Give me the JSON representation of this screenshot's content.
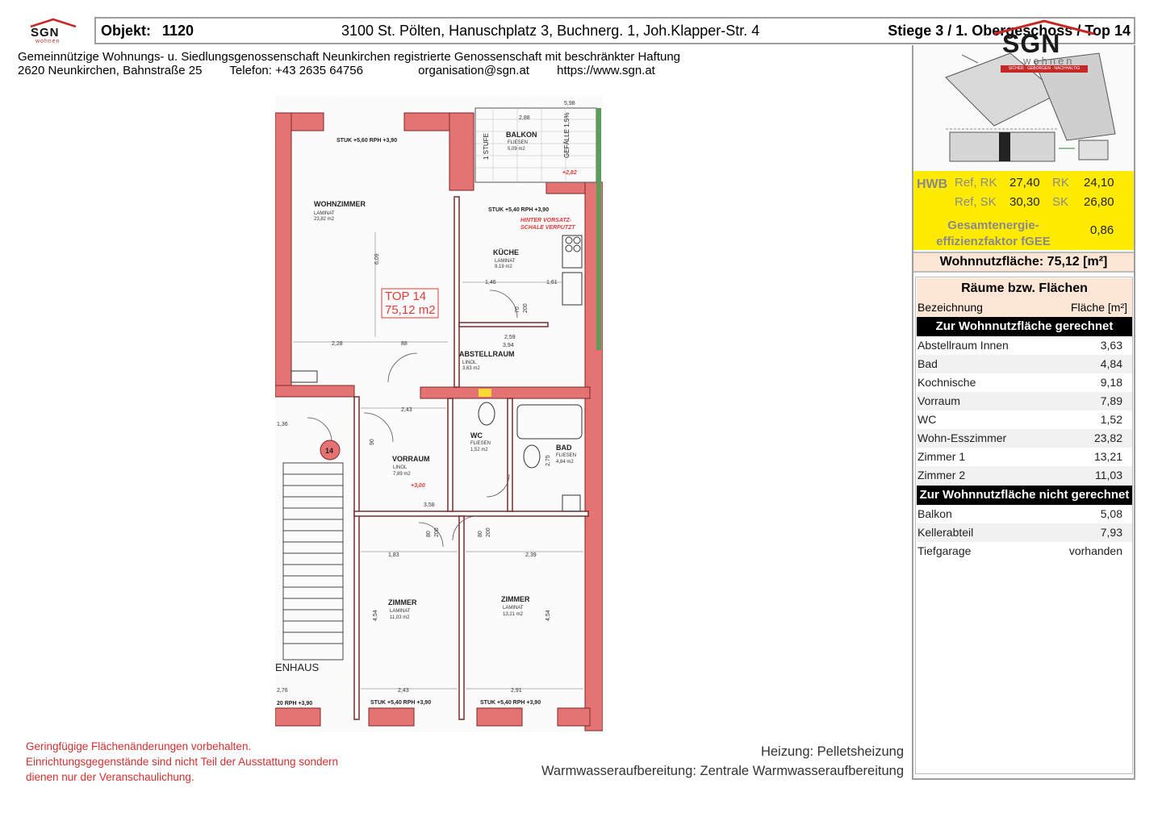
{
  "header": {
    "logo_small": "SGN",
    "logo_small_sub": "wohnen",
    "objekt_label": "Objekt:",
    "objekt_number": "1120",
    "address": "3100 St. Pölten, Hanuschplatz 3, Buchnerg. 1, Joh.Klapper-Str. 4",
    "stiege": "Stiege 3 / 1. Obergeschoss / Top 14"
  },
  "company": {
    "name": "Gemeinnützige Wohnungs- u. Siedlungsgenossenschaft Neunkirchen registrierte Genossenschaft mit beschränkter Haftung",
    "address": "2620 Neunkirchen, Bahnstraße 25",
    "phone": "Telefon: +43 2635 64756",
    "email": "organisation@sgn.at",
    "web": "https://www.sgn.at"
  },
  "brand": {
    "logo": "SGN",
    "logo_sub": "wohnen",
    "tagline": "SICHER · GEBORGEN · NACHHALTIG",
    "red": "#c62828",
    "yellow": "#ffeb00",
    "peach": "#fde6d6"
  },
  "energy": {
    "label": "HWB",
    "ref_rk_label": "Ref, RK",
    "ref_rk_value": "27,40",
    "rk_label": "RK",
    "rk_value": "24,10",
    "ref_sk_label": "Ref, SK",
    "ref_sk_value": "30,30",
    "sk_label": "SK",
    "sk_value": "26,80",
    "fgee_label_1": "Gesamtenergie-",
    "fgee_label_2": "effizienzfaktor fGEE",
    "fgee_value": "0,86"
  },
  "wohnnutzflaeche": "Wohnnutzfläche: 75,12 [m²]",
  "rooms": {
    "title": "Räume bzw. Flächen",
    "col_name": "Bezeichnung",
    "col_area": "Fläche [m²]",
    "section_included": "Zur Wohnnutzfläche gerechnet",
    "section_excluded": "Zur Wohnnutzfläche nicht gerechnet",
    "included": [
      {
        "name": "Abstellraum Innen",
        "area": "3,63"
      },
      {
        "name": "Bad",
        "area": "4,84"
      },
      {
        "name": "Kochnische",
        "area": "9,18"
      },
      {
        "name": "Vorraum",
        "area": "7,89"
      },
      {
        "name": "WC",
        "area": "1,52"
      },
      {
        "name": "Wohn-Esszimmer",
        "area": "23,82"
      },
      {
        "name": "Zimmer 1",
        "area": "13,21"
      },
      {
        "name": "Zimmer 2",
        "area": "11,03"
      }
    ],
    "excluded": [
      {
        "name": "Balkon",
        "area": "5,08"
      },
      {
        "name": "Kellerabteil",
        "area": "7,93"
      },
      {
        "name": "Tiefgarage",
        "area": "vorhanden"
      }
    ]
  },
  "plan": {
    "top_label": "TOP 14",
    "top_area": "75,12 m2",
    "wohnzimmer": "WOHNZIMMER",
    "wohnzimmer_floor": "LAMINAT",
    "wohnzimmer_area": "23,82 m2",
    "balkon": "BALKON",
    "balkon_floor": "FLIESEN",
    "balkon_area": "5,09 m2",
    "kueche": "KÜCHE",
    "kueche_floor": "LAMINAT",
    "kueche_area": "9,19 m2",
    "abstellraum": "ABSTELLRAUM",
    "abstellraum_floor": "LINOL",
    "abstellraum_area": "3,63 m2",
    "vorraum": "VORRAUM",
    "vorraum_floor": "LINOL",
    "vorraum_area": "7,89 m2",
    "wc": "WC",
    "wc_floor": "FLIESEN",
    "wc_area": "1,52 m2",
    "bad": "BAD",
    "bad_floor": "FLIESEN",
    "bad_area": "4,84 m2",
    "zimmer": "ZIMMER",
    "zimmer_floor": "LAMINAT",
    "zimmer_a_area": "11,03 m2",
    "zimmer_b_area": "13,21 m2",
    "stiegenhaus": "ENHAUS",
    "stuk_1": "STUK +5,60 RPH +3,90",
    "stuk_2": "STUK +5,40 RPH +3,90",
    "stuk_3": "STUK +5,40 RPH +3,90",
    "stuk_4": "STUK +5,40 RPH +3,90",
    "stuk_5": "20 RPH +3,90",
    "vorsatz_1": "HINTER VORSATZ-",
    "vorsatz_2": "SCHALE VERPUTZT",
    "stufe": "1 STUFE",
    "gefaelle": "GEFÄLLE 1,5%",
    "level_1": "+3,00",
    "level_2": "+2,82",
    "door_number": "14",
    "d_228": "2,28",
    "d_88": "88",
    "d_609": "6,09",
    "d_146": "1,46",
    "d_161": "1,61",
    "d_259": "2,59",
    "d_394": "3,94",
    "d_243": "2,43",
    "d_358": "3,58",
    "d_183": "1,83",
    "d_239": "2,39",
    "d_454": "4,54",
    "d_291": "2,91",
    "d_276": "2,76",
    "d_288": "2,88",
    "d_598": "5,98",
    "d_275": "2,75",
    "d_136": "1,36",
    "d_200": "200",
    "d_80": "80",
    "d_70": "70",
    "d_90": "90"
  },
  "footer": {
    "note_1": "Geringfügige Flächenänderungen vorbehalten.",
    "note_2": "Einrichtungsgegenstände sind nicht Teil der Ausstattung sondern",
    "note_3": "dienen nur der Veranschaulichung.",
    "heizung": "Heizung: Pelletsheizung",
    "warmwasser": "Warmwasseraufbereitung: Zentrale Warmwasseraufbereitung"
  }
}
